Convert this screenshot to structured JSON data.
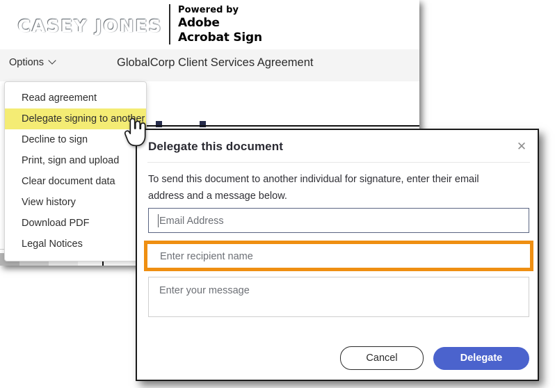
{
  "brand": {
    "logo_text": "CASEY JONES",
    "powered_by": "Powered by",
    "adobe": "Adobe",
    "product": "Acrobat Sign"
  },
  "toolbar": {
    "options_label": "Options",
    "chevron_icon": "chevron-down-icon",
    "document_title": "GlobalCorp Client Services Agreement"
  },
  "options_menu": {
    "items": [
      {
        "label": "Read agreement",
        "highlighted": false
      },
      {
        "label": "Delegate signing to another",
        "highlighted": true
      },
      {
        "label": "Decline to sign",
        "highlighted": false
      },
      {
        "label": "Print, sign and upload",
        "highlighted": false
      },
      {
        "label": "Clear document data",
        "highlighted": false
      },
      {
        "label": "View history",
        "highlighted": false
      },
      {
        "label": "Download PDF",
        "highlighted": false
      },
      {
        "label": "Legal Notices",
        "highlighted": false
      }
    ],
    "highlight_color": "#f4ec74"
  },
  "cursor": {
    "icon": "hand-pointer-cursor"
  },
  "dialog": {
    "title": "Delegate this document",
    "close_icon": "close-icon",
    "close_glyph": "✕",
    "description": "To send this document to another individual for signature, enter their email address and a message below.",
    "fields": {
      "email": {
        "placeholder": "Email Address",
        "value": "",
        "focused": true
      },
      "recipient_name": {
        "placeholder": "Enter recipient name",
        "value": "",
        "highlight_color": "#ef8f12"
      },
      "message": {
        "placeholder": "Enter your message",
        "value": ""
      }
    },
    "buttons": {
      "cancel": "Cancel",
      "delegate": "Delegate",
      "primary_color": "#4b63cd"
    }
  }
}
